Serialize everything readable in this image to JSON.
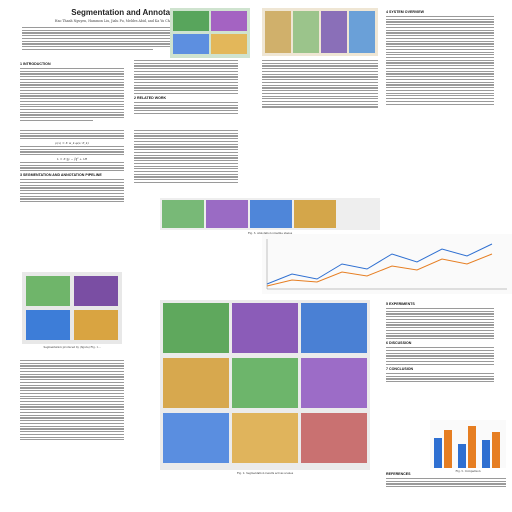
{
  "paper": {
    "title": "Segmentation and Annotation",
    "authors": "Hao Thanh Nguyen, Hammon Liu, Jialu Fu, Mel­des Abid, and Ka Yu Chang, Member, IEEE"
  },
  "sections": {
    "s1": "1 INTRODUCTION",
    "s2": "2 RELATED WORK",
    "s3": "3 SEGMENTATION AND ANNOTATION PIPELINE",
    "s4": "4 SYSTEM OVERVIEW",
    "s5": "5 EXPERIMENTS",
    "s6": "6 DISCUSSION",
    "s7": "7 CONCLUSION",
    "refs": "REFERENCES"
  },
  "figures": {
    "fig_ex": "Segmentation produced by (figure) Fig. 1...",
    "fig_grid": "Fig. 2. Segmentation results across scenes",
    "fig_strip": "Fig. 3. Annotation pipeline stages",
    "fig_plot": "Fig. 4. Evaluation chart",
    "fig_bars": "Fig. 5. Comparison"
  },
  "colors": {
    "green": "#4caf50",
    "purple": "#8e44ad",
    "blue": "#2e6fd1",
    "orange": "#e67e22",
    "yellow": "#f1c40f",
    "gray": "#9a9a9a"
  }
}
